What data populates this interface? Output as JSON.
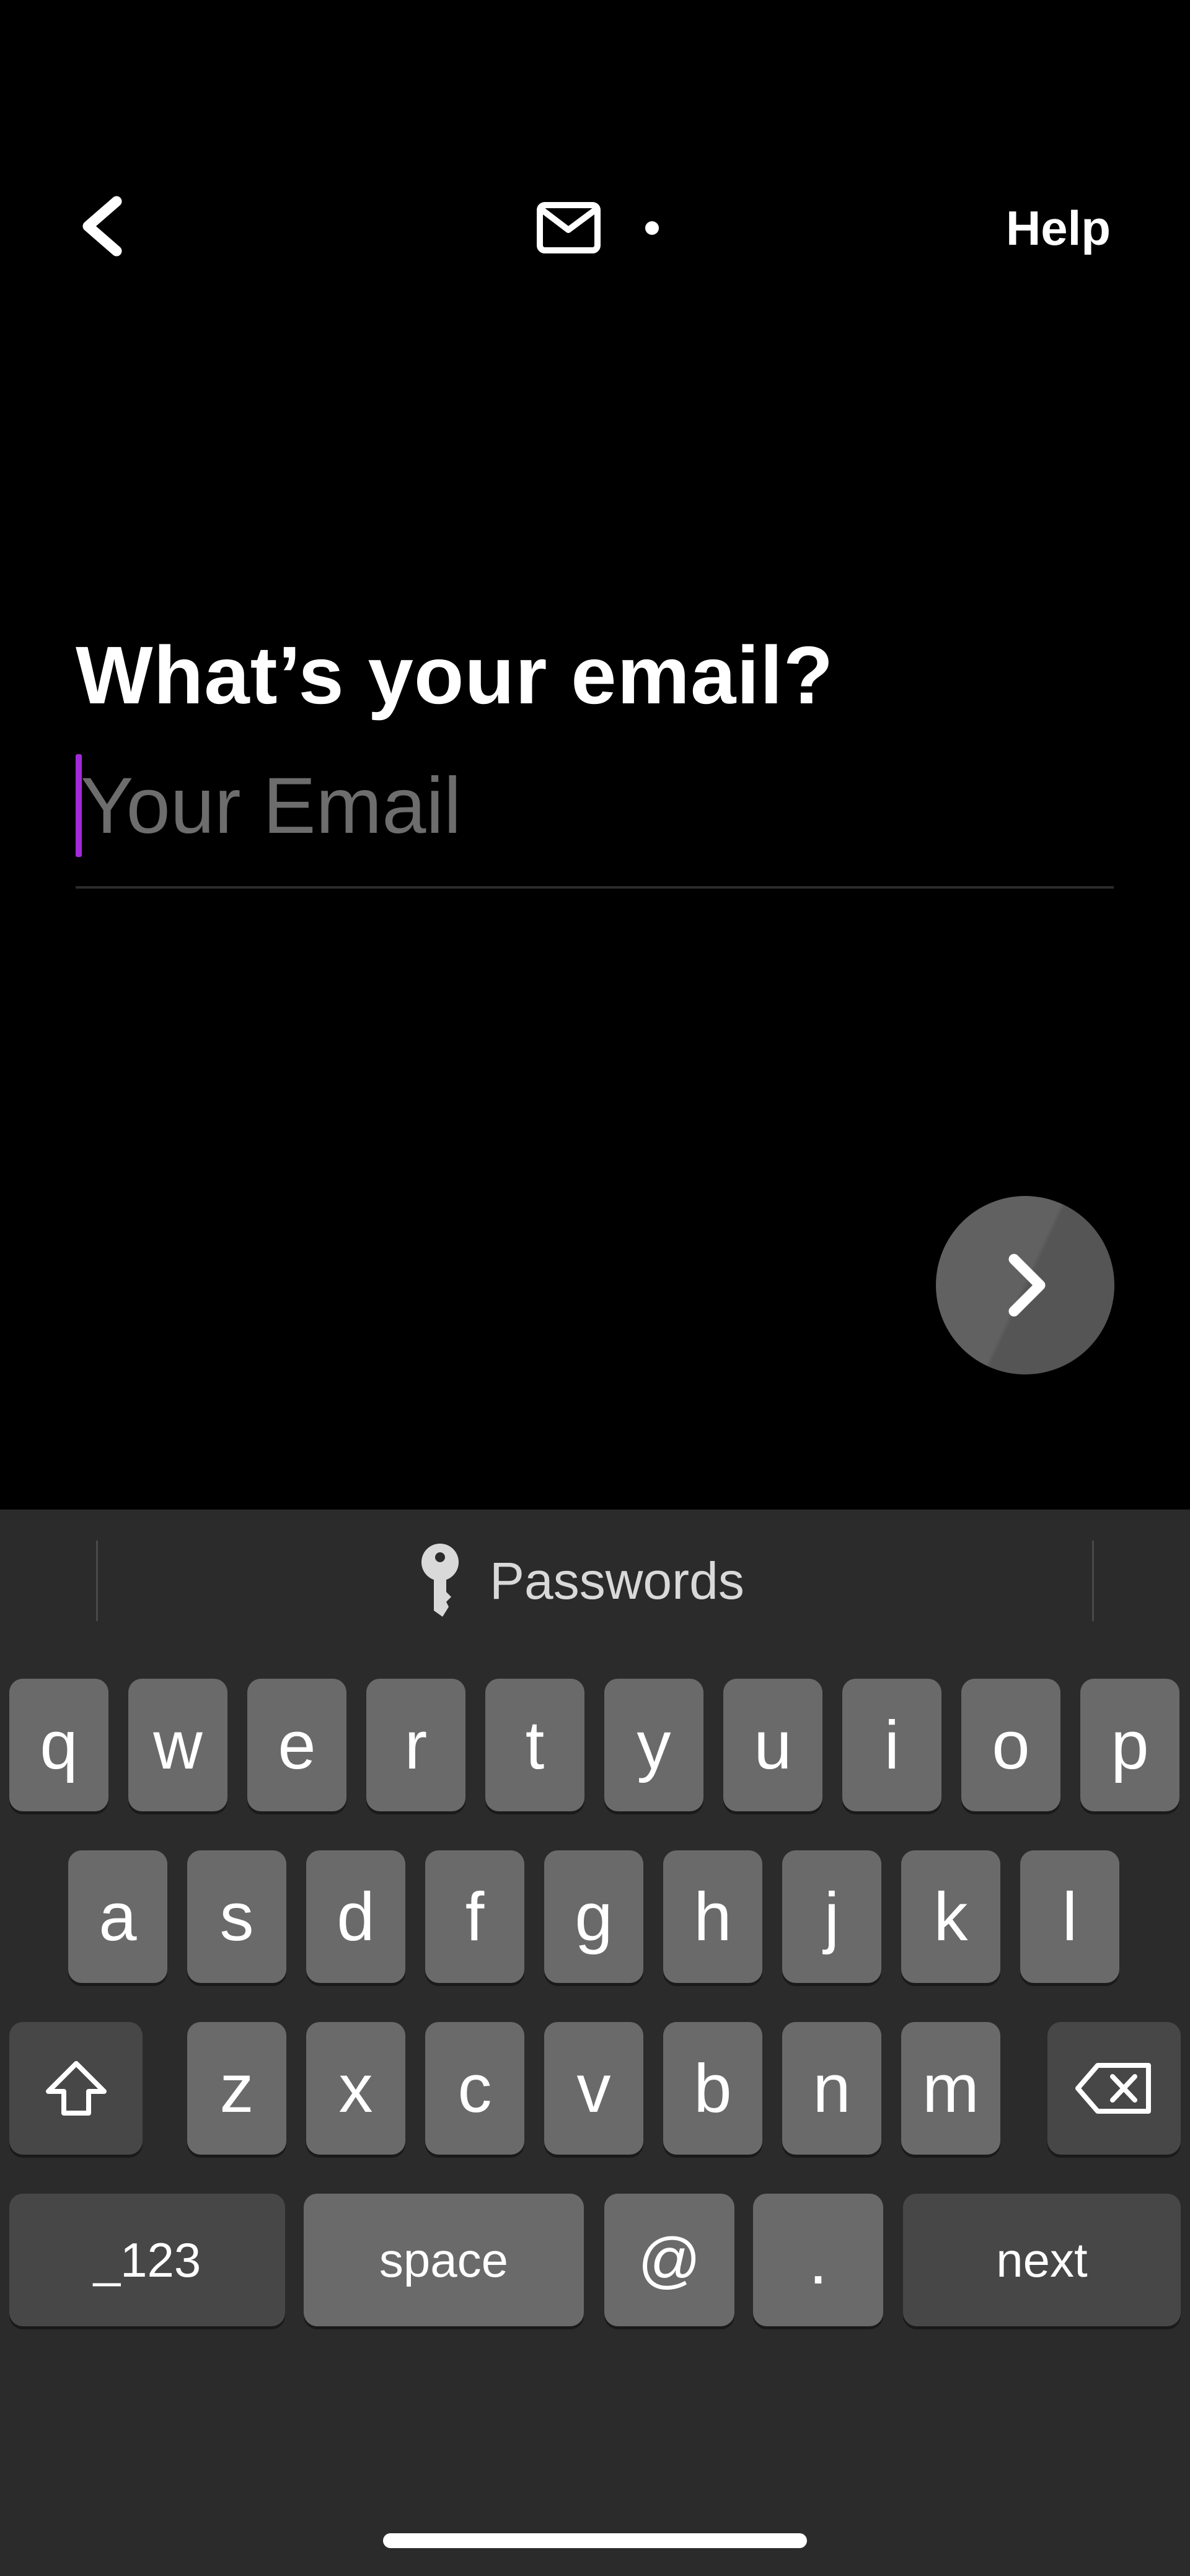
{
  "nav": {
    "help_label": "Help"
  },
  "main": {
    "title": "What’s your email?",
    "email_value": "",
    "email_placeholder": "Your Email"
  },
  "colors": {
    "background": "#000000",
    "accent_caret": "#a12bd9",
    "keyboard_bg": "#2b2b2b",
    "key_bg": "#6a6a6a",
    "key_dark_bg": "#474747"
  },
  "icons": {
    "back": "chevron-left-icon",
    "step": "mail-icon",
    "next": "chevron-right-icon",
    "passwords": "key-icon",
    "shift": "shift-arrow-icon",
    "delete": "backspace-icon"
  },
  "keyboard": {
    "suggestion": "Passwords",
    "row1": [
      "q",
      "w",
      "e",
      "r",
      "t",
      "y",
      "u",
      "i",
      "o",
      "p"
    ],
    "row2": [
      "a",
      "s",
      "d",
      "f",
      "g",
      "h",
      "j",
      "k",
      "l"
    ],
    "row3": [
      "z",
      "x",
      "c",
      "v",
      "b",
      "n",
      "m"
    ],
    "numbers_label": "_123",
    "space_label": "space",
    "at_label": "@",
    "dot_label": ".",
    "next_label": "next"
  }
}
